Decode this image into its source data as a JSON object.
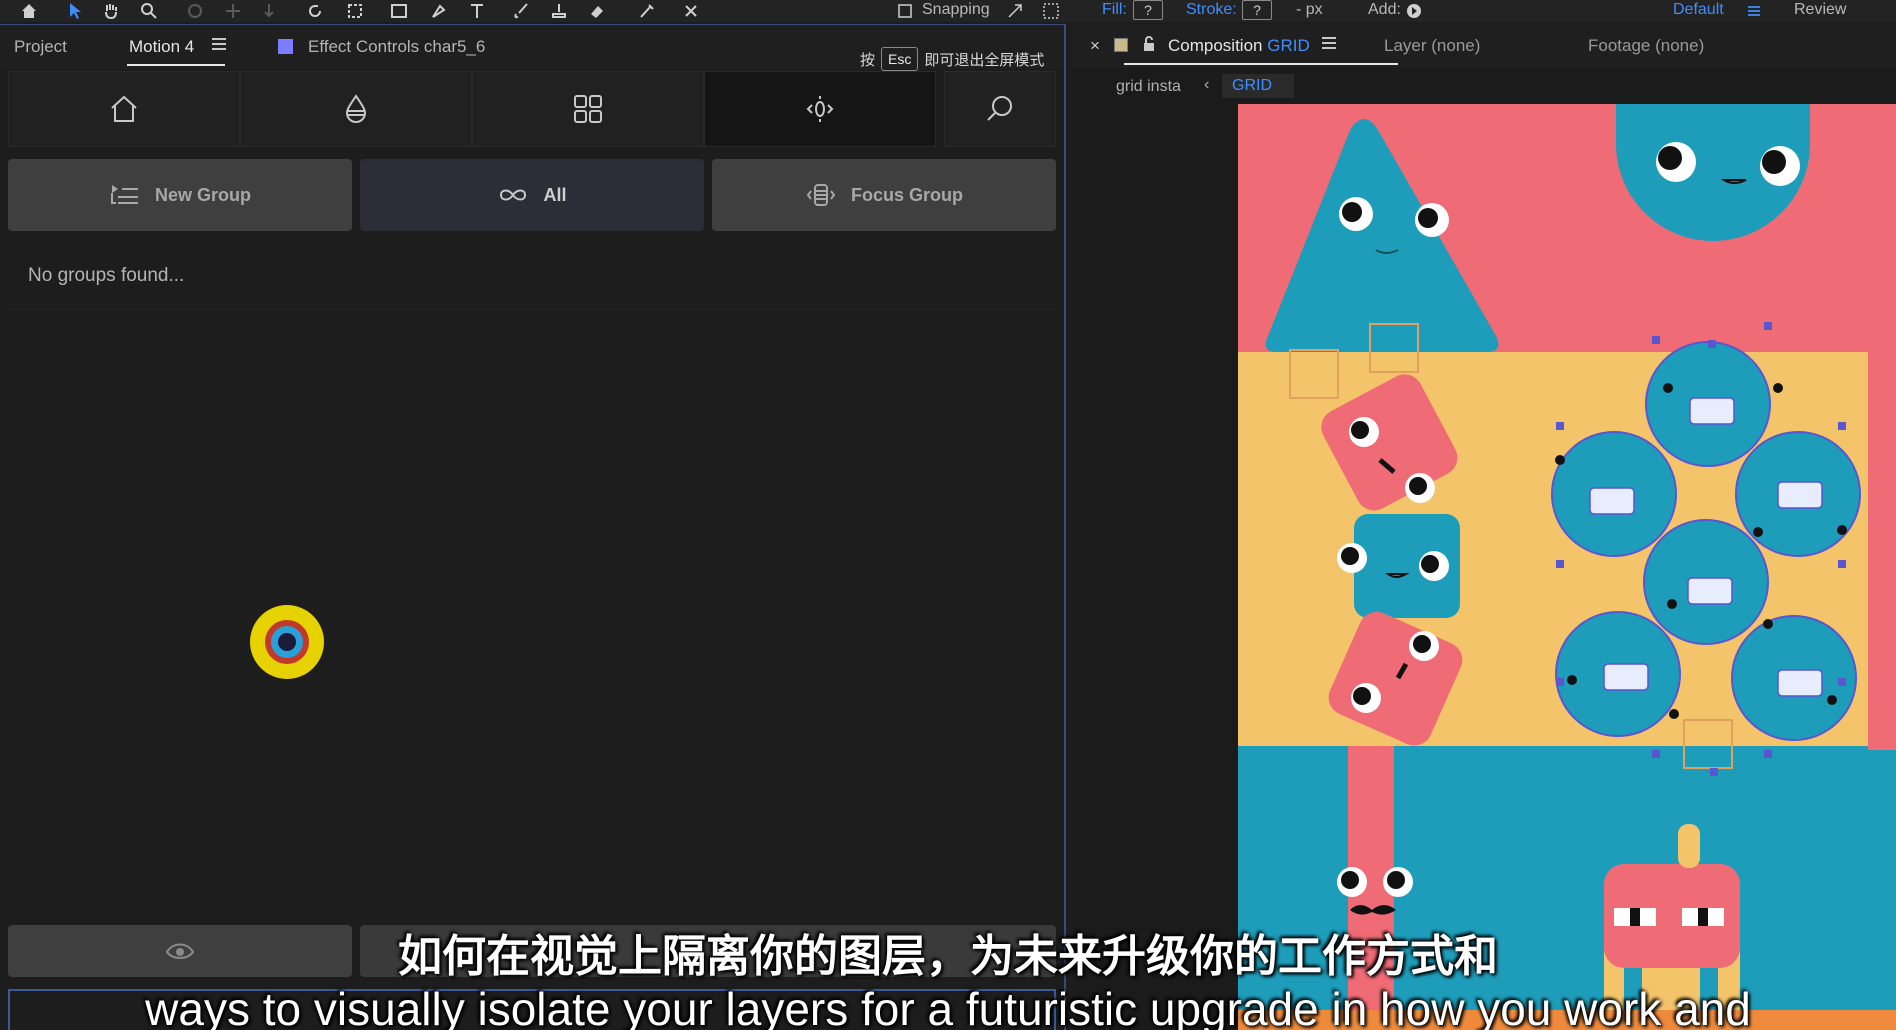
{
  "toolbar": {
    "snapping_label": "Snapping",
    "fill_label": "Fill:",
    "fill_value": "?",
    "stroke_label": "Stroke:",
    "stroke_value": "?",
    "stroke_px": "- px",
    "add_label": "Add:",
    "workspace": "Default",
    "review_label": "Review"
  },
  "left_panel": {
    "tabs": [
      {
        "label": "Project"
      },
      {
        "label": "Motion 4"
      },
      {
        "label": "Effect Controls char5_6"
      }
    ],
    "esc_hint": {
      "prefix": "按",
      "key": "Esc",
      "suffix": "即可退出全屏模式"
    },
    "nav_icons": [
      "home-icon",
      "drop-icon",
      "grid-icon",
      "anchor-icon",
      "search-icon"
    ],
    "buttons": {
      "new_group": "New Group",
      "all": "All",
      "focus_group": "Focus Group"
    },
    "empty_message": "No groups found..."
  },
  "right_panel": {
    "tabs": {
      "composition_prefix": "Composition",
      "composition_name": "GRID",
      "layer": "Layer (none)",
      "footage": "Footage (none)"
    },
    "breadcrumbs": {
      "parent": "grid insta",
      "current": "GRID"
    }
  },
  "subtitles": {
    "zh": "如何在视觉上隔离你的图层，为未来升级你的工作方式和",
    "en": "ways to visually isolate your layers for a futuristic upgrade in how you work and"
  },
  "colors": {
    "accent_blue": "#3d8fff",
    "canvas_coral": "#ef6b75",
    "canvas_yellow": "#f4c46a",
    "canvas_teal": "#1e9dba"
  }
}
